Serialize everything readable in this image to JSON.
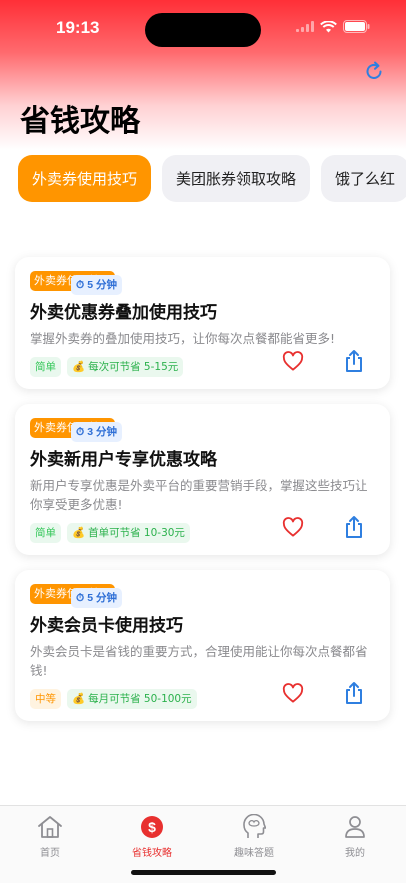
{
  "status_bar": {
    "time": "19:13"
  },
  "page": {
    "title": "省钱攻略"
  },
  "tabs": [
    {
      "label": "外卖券使用技巧",
      "active": true
    },
    {
      "label": "美团胀券领取攻略",
      "active": false
    },
    {
      "label": "饿了么红",
      "active": false
    }
  ],
  "cards": [
    {
      "tag": "外卖券使用技巧",
      "title": "外卖优惠券叠加使用技巧",
      "desc": "掌握外卖券的叠加使用技巧，让你每次点餐都能省更多!",
      "difficulty": "简单",
      "time": "5 分钟",
      "saving": "每次可节省 5-15元"
    },
    {
      "tag": "外卖券使用技巧",
      "title": "外卖新用户专享优惠攻略",
      "desc": "新用户专享优惠是外卖平台的重要营销手段，掌握这些技巧让你享受更多优惠!",
      "difficulty": "简单",
      "time": "3 分钟",
      "saving": "首单可节省 10-30元"
    },
    {
      "tag": "外卖券使用技巧",
      "title": "外卖会员卡使用技巧",
      "desc": "外卖会员卡是省钱的重要方式，合理使用能让你每次点餐都省钱!",
      "difficulty": "中等",
      "time": "5 分钟",
      "saving": "每月可节省 50-100元"
    }
  ],
  "tabbar": [
    {
      "label": "首页",
      "icon": "house-icon"
    },
    {
      "label": "省钱攻略",
      "icon": "dollar-circle-icon",
      "active": true
    },
    {
      "label": "趣味答题",
      "icon": "brain-head-icon"
    },
    {
      "label": "我的",
      "icon": "person-icon"
    }
  ],
  "colors": {
    "accent": "#ff9500",
    "brand_red": "#e8302f",
    "link_blue": "#2f7fe0"
  }
}
